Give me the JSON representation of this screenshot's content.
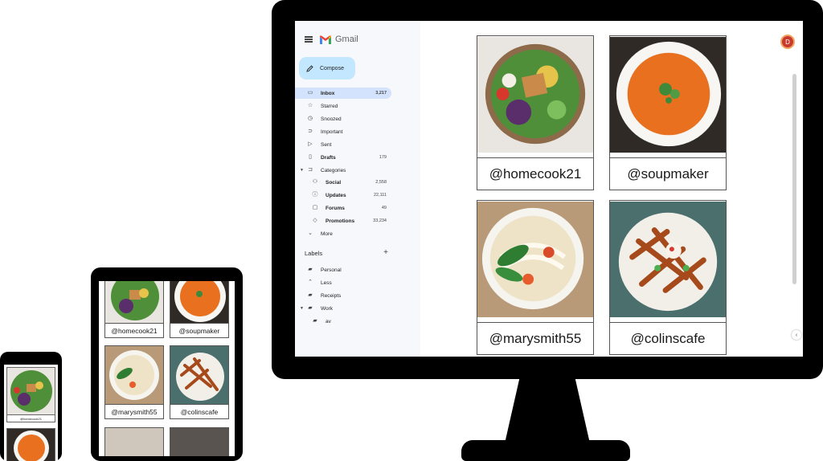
{
  "gmail": {
    "app_name": "Gmail",
    "compose_label": "Compose",
    "avatar_initial": "D",
    "nav": [
      {
        "label": "Inbox",
        "count": "3,217",
        "icon": "inbox-icon"
      },
      {
        "label": "Starred",
        "count": "",
        "icon": "star-icon"
      },
      {
        "label": "Snoozed",
        "count": "",
        "icon": "clock-icon"
      },
      {
        "label": "Important",
        "count": "",
        "icon": "important-icon"
      },
      {
        "label": "Sent",
        "count": "",
        "icon": "send-icon"
      },
      {
        "label": "Drafts",
        "count": "179",
        "icon": "draft-icon"
      },
      {
        "label": "Categories",
        "count": "",
        "icon": "label-icon"
      }
    ],
    "categories": [
      {
        "label": "Social",
        "count": "2,558",
        "icon": "people-icon"
      },
      {
        "label": "Updates",
        "count": "22,111",
        "icon": "info-icon"
      },
      {
        "label": "Forums",
        "count": "49",
        "icon": "forum-icon"
      },
      {
        "label": "Promotions",
        "count": "33,234",
        "icon": "tag-icon"
      }
    ],
    "more_label": "More",
    "labels_heading": "Labels",
    "labels": [
      {
        "label": "Personal"
      },
      {
        "label": "Less"
      },
      {
        "label": "Receipts"
      },
      {
        "label": "Work"
      },
      {
        "label": "av"
      }
    ]
  },
  "feed": {
    "posts": [
      {
        "handle": "@homecook21",
        "dish": "salad bowl"
      },
      {
        "handle": "@soupmaker",
        "dish": "tomato soup"
      },
      {
        "handle": "@marysmith55",
        "dish": "noodle soup"
      },
      {
        "handle": "@colinscafe",
        "dish": "sweet potato fries"
      }
    ]
  },
  "colors": {
    "compose_bg": "#c2e7ff",
    "active_nav_bg": "#d3e3fd",
    "sidebar_bg": "#f6f8fc",
    "avatar_bg": "#c73b2c"
  }
}
